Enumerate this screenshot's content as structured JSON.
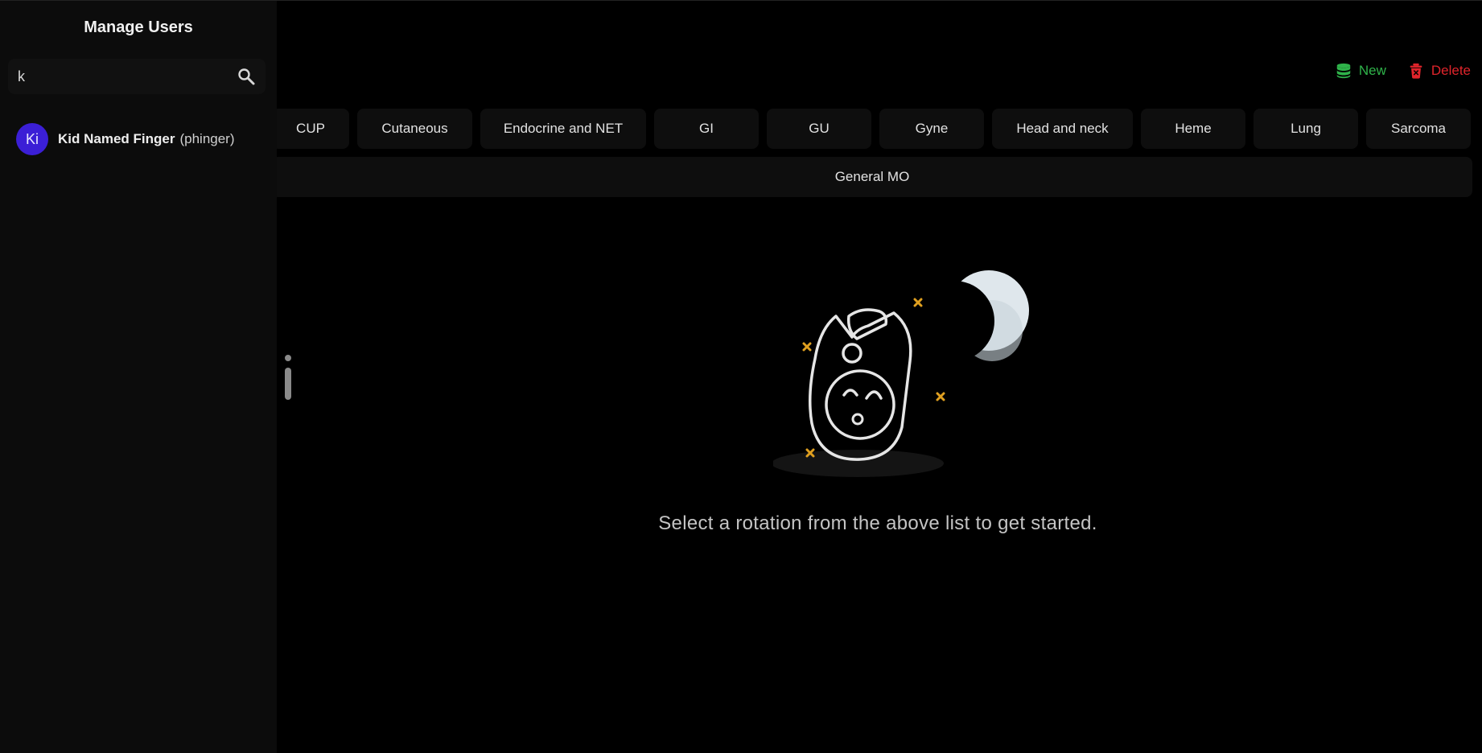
{
  "sidebar": {
    "title": "Manage Users",
    "search": {
      "value": "k",
      "icon": "search-icon"
    },
    "users": [
      {
        "initials": "Ki",
        "name": "Kid Named Finger",
        "handle": "(phinger)",
        "avatar_color": "#3b1fd6"
      }
    ]
  },
  "toolbar": {
    "new_label": "New",
    "delete_label": "Delete",
    "new_color": "#2fb34a",
    "delete_color": "#e0242b"
  },
  "tabs": [
    "CUP",
    "Cutaneous",
    "Endocrine and NET",
    "GI",
    "GU",
    "Gyne",
    "Head and neck",
    "Heme",
    "Lung",
    "Sarcoma"
  ],
  "general_tab": "General MO",
  "empty_state": {
    "message": "Select a rotation from the above list to get started."
  },
  "colors": {
    "background": "#000000",
    "sidebar": "#0c0c0c",
    "tab_bg": "#0e0e0e",
    "star_accent": "#e0a020"
  }
}
